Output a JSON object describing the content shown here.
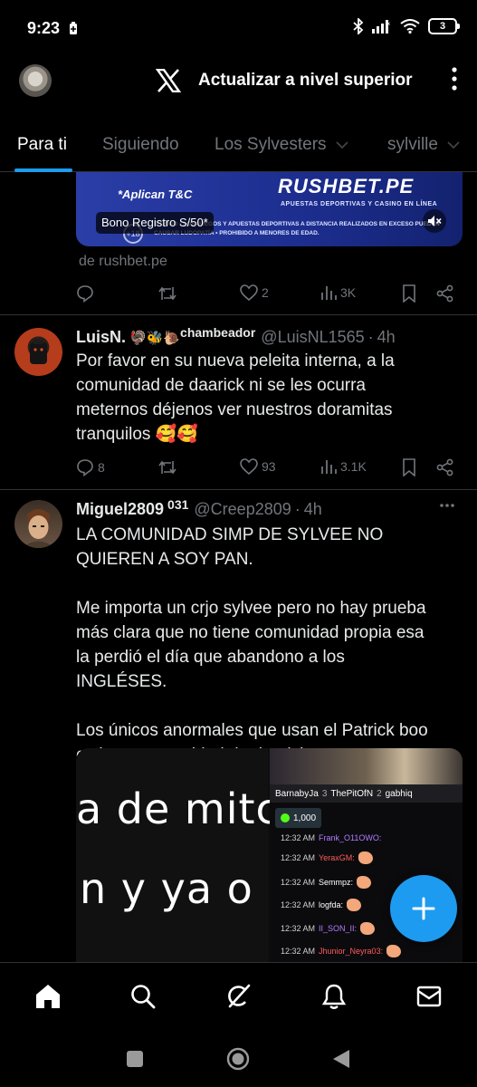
{
  "status_bar": {
    "time": "9:23",
    "battery_level": "3",
    "icons": [
      "battery-saver-icon",
      "bluetooth-icon",
      "signal-icon",
      "wifi-icon",
      "battery-icon"
    ]
  },
  "header": {
    "upgrade_label": "Actualizar a nivel superior",
    "logo": "x-logo-icon",
    "menu_icon": "more-vertical-icon"
  },
  "tabs": [
    {
      "label": "Para ti",
      "active": true
    },
    {
      "label": "Siguiendo",
      "active": false
    },
    {
      "label": "Los Sylvesters",
      "active": false,
      "has_dropdown": true
    },
    {
      "label": "sylville",
      "active": false,
      "has_dropdown": true
    }
  ],
  "ad": {
    "terms": "*Aplican T&C",
    "brand": "RUSHBET.PE",
    "brand_subtitle": "APUESTAS DEPORTIVAS Y CASINO EN LÍNEA",
    "disclaimer": "BILIDAD • LOS JUEGOS Y APUESTAS DEPORTIVAS A DISTANCIA REALIZADOS EN EXCESO PUEDEN CAUSAR LUDOPATÍA • PROHIBIDO A MENORES DE EDAD.",
    "age_badge": "+18",
    "caption_pill": "Bono Registro S/50*",
    "source": "de rushbet.pe",
    "stats": {
      "replies": "",
      "reposts": "",
      "likes": "2",
      "views": "3K"
    }
  },
  "tweets": [
    {
      "name": "LuisN.",
      "name_suffix": "chambeador",
      "handle": "@LuisNL1565",
      "time": "4h",
      "text": "Por favor en su nueva peleita interna, a la comunidad de daarick ni se les ocurra meternos déjenos ver nuestros doramitas tranquilos 🥰🥰",
      "stats": {
        "replies": "8",
        "reposts": "",
        "likes": "93",
        "views": "3.1K"
      }
    },
    {
      "name": "Miguel2809",
      "name_suffix": "031",
      "handle": "@Creep2809",
      "time": "4h",
      "text": "LA COMUNIDAD SIMP DE SYLVEE NO QUIEREN A SOY PAN.\n\nMe importa un crjo sylvee pero no hay prueba más clara que no tiene comunidad propia esa la perdió el día que abandono a los INGLÉSES.\n\nLos únicos anormales que usan el Patrick boo es la ex comunidad de daarick puro peruano."
    }
  ],
  "media": {
    "caption_line_1": "a de mitc",
    "caption_line_2": "n y ya o",
    "donors": [
      "BarnabyJa",
      "3",
      "ThePitOfN",
      "2",
      "gabhiq"
    ],
    "coins": "1,000",
    "chat": [
      {
        "time": "12:32 AM",
        "user": "Frank_O11OWO:"
      },
      {
        "time": "12:32 AM",
        "user": "YeraxGM:"
      },
      {
        "time": "12:32 AM",
        "user": "Semmpz:"
      },
      {
        "time": "12:32 AM",
        "user": "logfda:"
      },
      {
        "time": "12:32 AM",
        "user": "II_SON_II:"
      },
      {
        "time": "12:32 AM",
        "user": "Jhunior_Neyra03:"
      }
    ]
  },
  "fab": {
    "icon": "plus-icon"
  },
  "bottom_nav": [
    "home-icon",
    "search-icon",
    "grok-icon",
    "notifications-icon",
    "messages-icon"
  ],
  "system_nav": [
    "recents-icon",
    "home-circle-icon",
    "back-icon"
  ],
  "colors": {
    "accent": "#1d9bf0",
    "background": "#000000",
    "muted": "#71767b",
    "divider": "#2f3336"
  }
}
